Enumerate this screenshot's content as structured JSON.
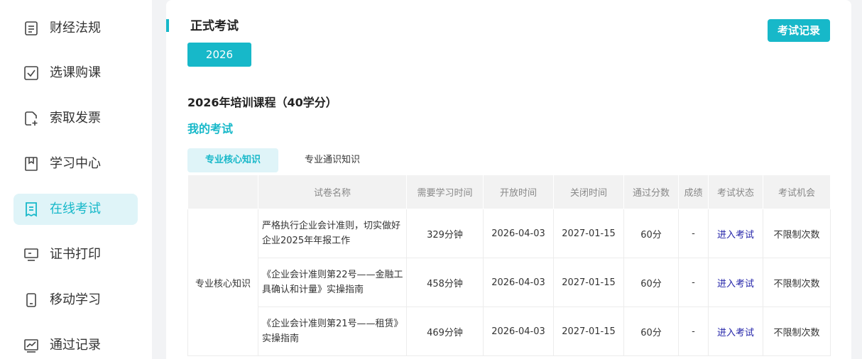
{
  "sidebar": {
    "items": [
      {
        "label": "财经法规",
        "icon": "document-icon"
      },
      {
        "label": "选课购课",
        "icon": "checkbox-icon"
      },
      {
        "label": "索取发票",
        "icon": "file-add-icon"
      },
      {
        "label": "学习中心",
        "icon": "bookmark-icon"
      },
      {
        "label": "在线考试",
        "icon": "exam-icon"
      },
      {
        "label": "证书打印",
        "icon": "monitor-icon"
      },
      {
        "label": "移动学习",
        "icon": "mobile-icon"
      },
      {
        "label": "通过记录",
        "icon": "chart-icon"
      }
    ],
    "active_index": 4
  },
  "main": {
    "title": "正式考试",
    "record_button": "考试记录",
    "year_button": "2026",
    "course_title": "2026年培训课程（40学分）",
    "my_exam": "我的考试",
    "tabs": [
      {
        "label": "专业核心知识",
        "active": true
      },
      {
        "label": "专业通识知识",
        "active": false
      }
    ],
    "table": {
      "headers": [
        "",
        "试卷名称",
        "需要学习时间",
        "开放时间",
        "关闭时间",
        "通过分数",
        "成绩",
        "考试状态",
        "考试机会"
      ],
      "group_label": "专业核心知识",
      "rows": [
        {
          "name": "严格执行企业会计准则，切实做好企业2025年年报工作",
          "study_time": "329分钟",
          "open": "2026-04-03",
          "close": "2027-01-15",
          "pass": "60分",
          "score": "-",
          "status": "进入考试",
          "chances": "不限制次数"
        },
        {
          "name": "《企业会计准则第22号——金融工具确认和计量》实操指南",
          "study_time": "458分钟",
          "open": "2026-04-03",
          "close": "2027-01-15",
          "pass": "60分",
          "score": "-",
          "status": "进入考试",
          "chances": "不限制次数"
        },
        {
          "name": "《企业会计准则第21号——租赁》实操指南",
          "study_time": "469分钟",
          "open": "2026-04-03",
          "close": "2027-01-15",
          "pass": "60分",
          "score": "-",
          "status": "进入考试",
          "chances": "不限制次数"
        }
      ]
    }
  },
  "colors": {
    "accent": "#17b8c9",
    "active_bg": "#dff4f8",
    "link": "#2222a8"
  }
}
